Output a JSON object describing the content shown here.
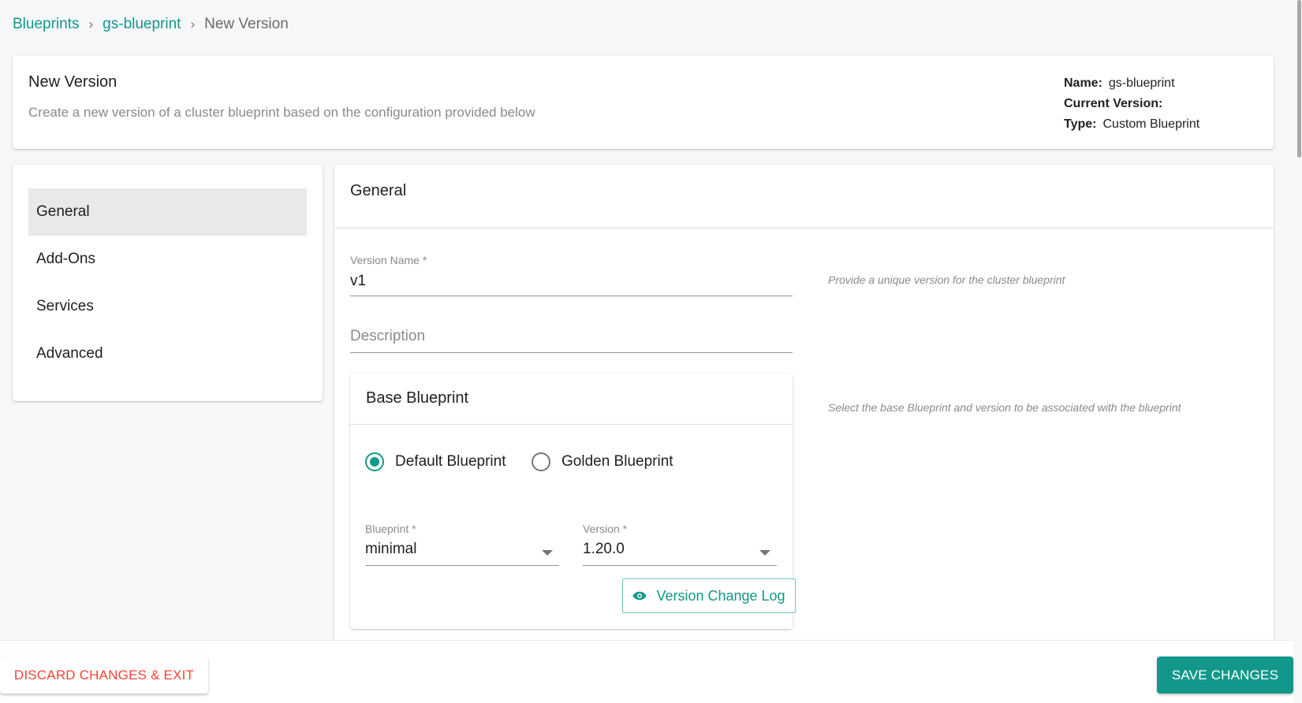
{
  "breadcrumb": {
    "items": [
      "Blueprints",
      "gs-blueprint"
    ],
    "current": "New Version",
    "separator": "›"
  },
  "header": {
    "title": "New Version",
    "subtitle": "Create a new version of a cluster blueprint based on the configuration provided below",
    "meta": {
      "name_label": "Name:",
      "name_value": "gs-blueprint",
      "current_version_label": "Current Version:",
      "current_version_value": "",
      "type_label": "Type:",
      "type_value": "Custom Blueprint"
    }
  },
  "sidebar": {
    "items": [
      {
        "label": "General",
        "active": true
      },
      {
        "label": "Add-Ons",
        "active": false
      },
      {
        "label": "Services",
        "active": false
      },
      {
        "label": "Advanced",
        "active": false
      }
    ]
  },
  "main": {
    "title": "General",
    "version_name": {
      "label": "Version Name *",
      "value": "v1",
      "hint": "Provide a unique version for the cluster blueprint"
    },
    "description": {
      "placeholder": "Description",
      "value": ""
    },
    "base_blueprint": {
      "title": "Base Blueprint",
      "hint": "Select the base Blueprint and version to be associated with the blueprint",
      "radios": [
        {
          "label": "Default Blueprint",
          "checked": true
        },
        {
          "label": "Golden Blueprint",
          "checked": false
        }
      ],
      "blueprint_select": {
        "label": "Blueprint *",
        "value": "minimal"
      },
      "version_select": {
        "label": "Version *",
        "value": "1.20.0"
      },
      "changelog_button": {
        "label": "Version Change Log",
        "icon": "eye-icon"
      }
    }
  },
  "footer": {
    "discard_label": "DISCARD CHANGES & EXIT",
    "save_label": "SAVE CHANGES"
  },
  "colors": {
    "accent": "#12988a",
    "danger": "#f44336",
    "background": "#f6f7f9"
  }
}
